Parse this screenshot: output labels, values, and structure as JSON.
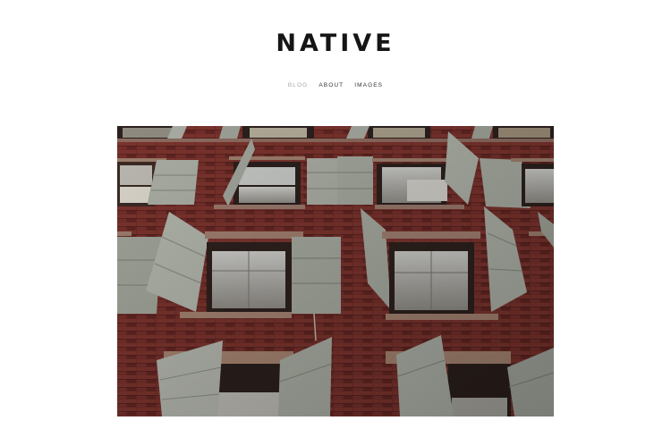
{
  "site": {
    "title": "NATIVE"
  },
  "nav": {
    "items": [
      {
        "label": "BLOG",
        "active": true
      },
      {
        "label": "ABOUT",
        "active": false
      },
      {
        "label": "IMAGES",
        "active": false
      }
    ]
  },
  "colors": {
    "background": "#ffffff",
    "title": "#151515",
    "nav_active": "#a9a9a9",
    "nav_default": "#333333",
    "brick": "#6e2a26",
    "shutter": "#a6aaa0"
  },
  "hero": {
    "subject": "brick-facade-with-open-shutters"
  }
}
